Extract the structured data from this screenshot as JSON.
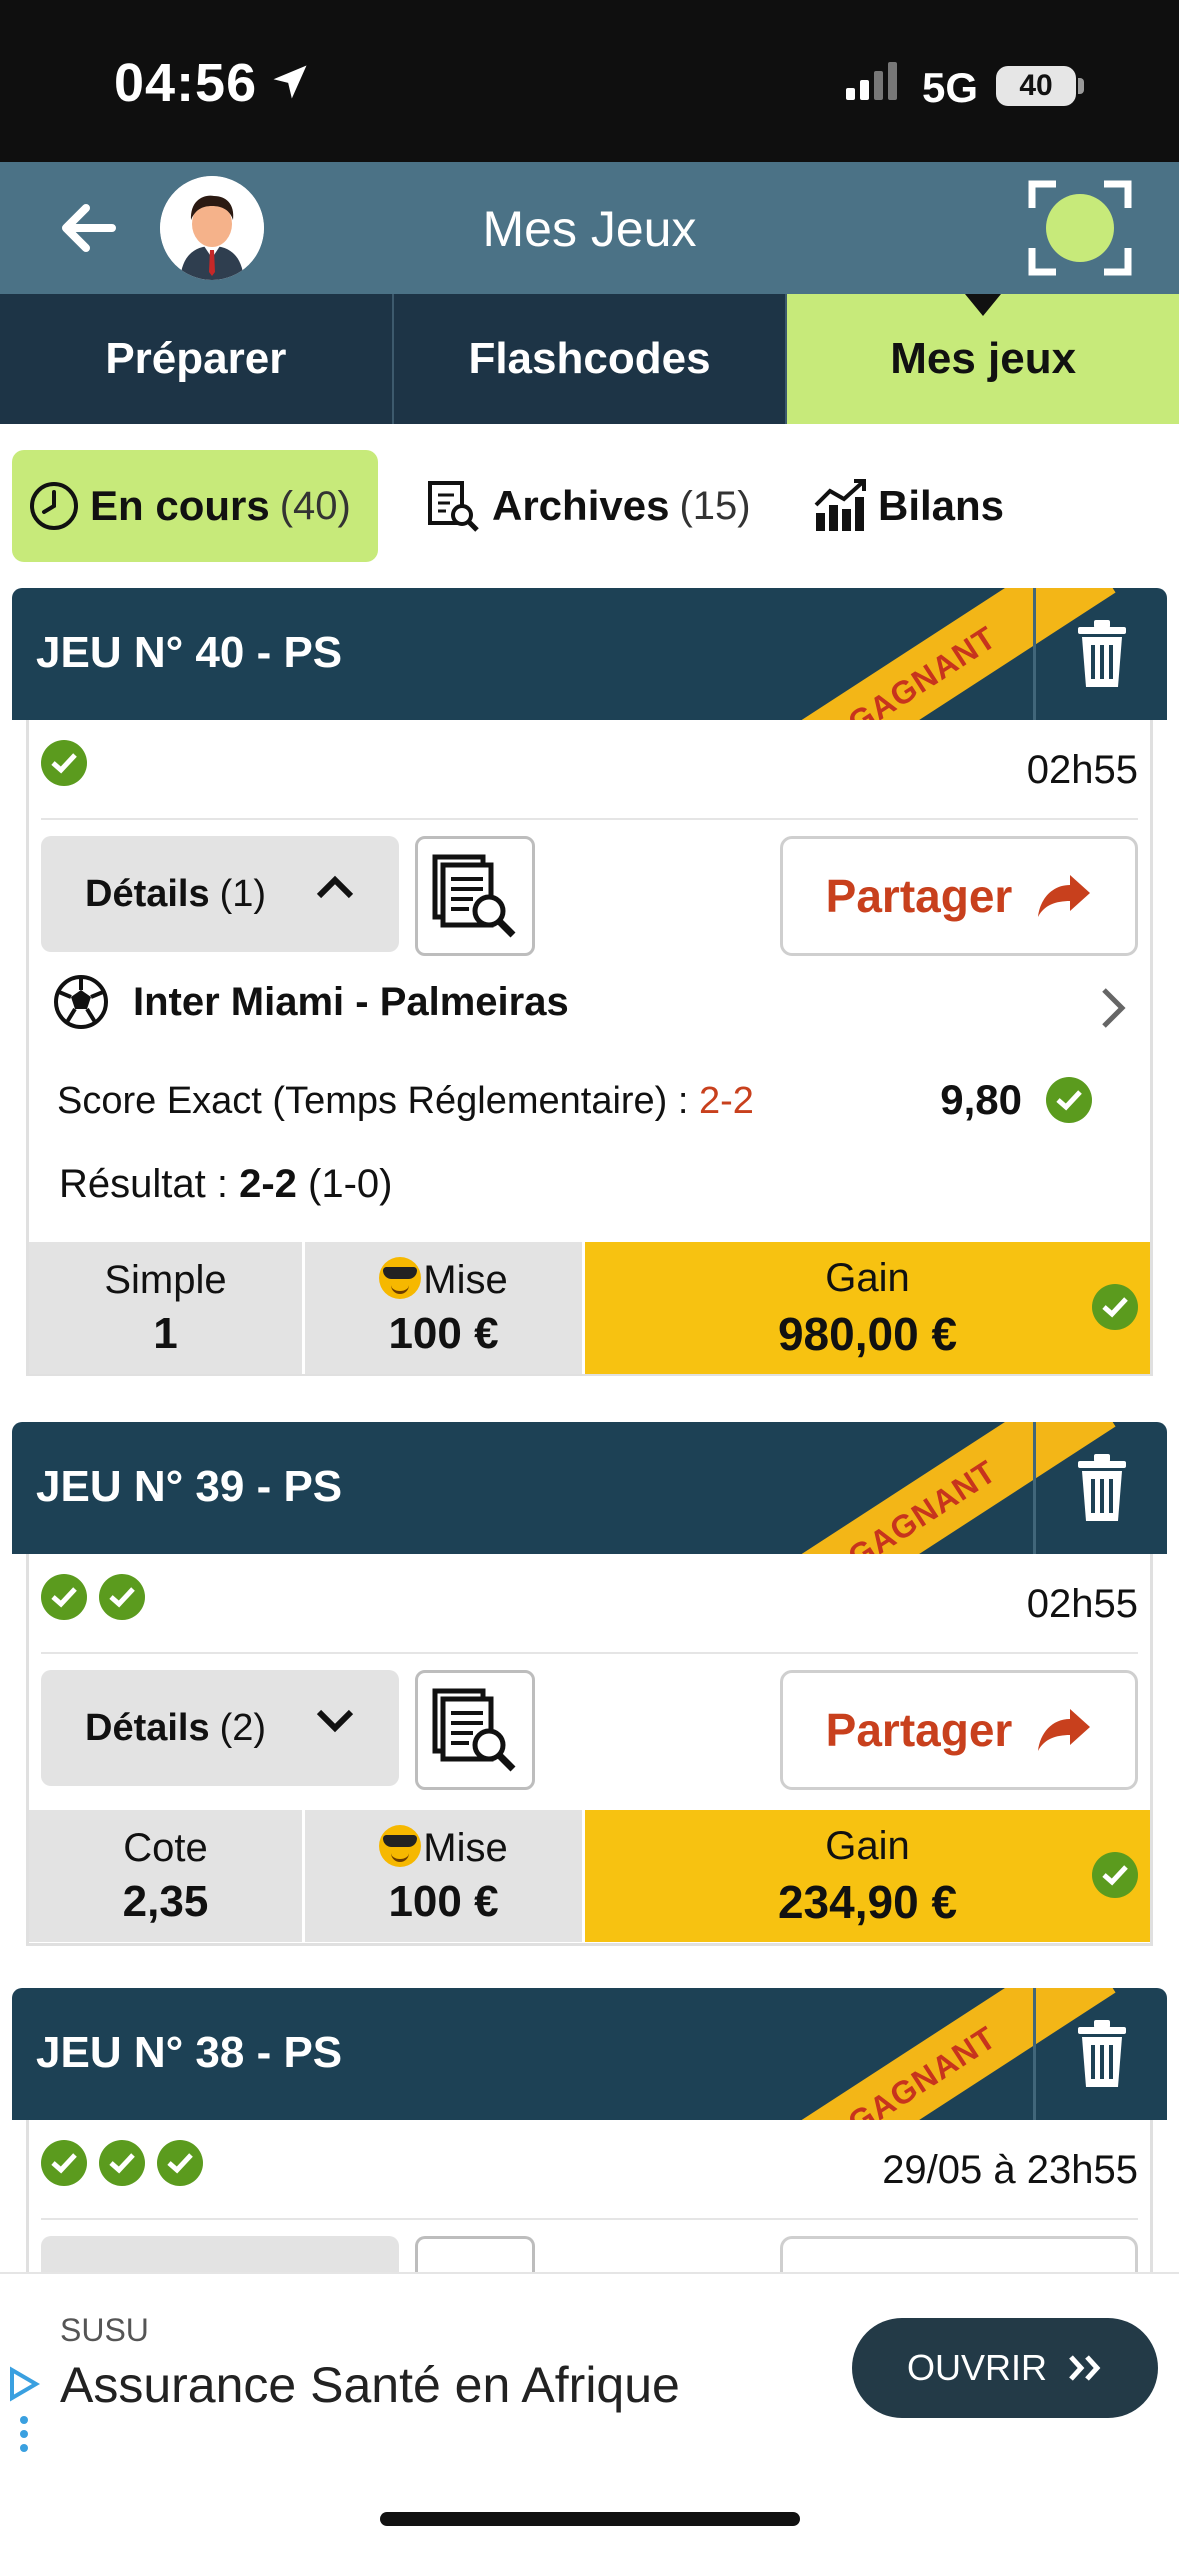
{
  "status_bar": {
    "time": "04:56",
    "network": "5G",
    "battery": "40"
  },
  "header": {
    "title": "Mes Jeux"
  },
  "tabs": [
    {
      "label": "Préparer",
      "active": false
    },
    {
      "label": "Flashcodes",
      "active": false
    },
    {
      "label": "Mes jeux",
      "active": true
    }
  ],
  "subtabs": {
    "en_cours": {
      "label": "En cours",
      "count": "(40)"
    },
    "archives": {
      "label": "Archives",
      "count": "(15)"
    },
    "bilans": {
      "label": "Bilans"
    }
  },
  "colors": {
    "accent_green": "#c7ea7a",
    "header_blue": "#4b7286",
    "card_navy": "#1d4155",
    "gain_yellow": "#f7c211",
    "share_red": "#c8401d",
    "check_green": "#5b9b1e"
  },
  "cards": [
    {
      "title": "JEU N° 40 - PS",
      "ribbon": "GAGNANT",
      "checks": 1,
      "time": "02h55",
      "details_label": "Détails",
      "details_count": "(1)",
      "share_label": "Partager",
      "match": "Inter Miami - Palmeiras",
      "bet_label": "Score Exact (Temps Réglementaire) :",
      "bet_score": "2-2",
      "odds": "9,80",
      "result_label": "Résultat :",
      "result_score": "2-2",
      "result_half": "(1-0)",
      "summary": {
        "type_label": "Simple",
        "type_value": "1",
        "stake_label": "Mise",
        "stake_value": "100 €",
        "gain_label": "Gain",
        "gain_value": "980,00 €"
      }
    },
    {
      "title": "JEU N° 39 - PS",
      "ribbon": "GAGNANT",
      "checks": 2,
      "time": "02h55",
      "details_label": "Détails",
      "details_count": "(2)",
      "share_label": "Partager",
      "summary": {
        "type_label": "Cote",
        "type_value": "2,35",
        "stake_label": "Mise",
        "stake_value": "100 €",
        "gain_label": "Gain",
        "gain_value": "234,90 €"
      }
    },
    {
      "title": "JEU N° 38 - PS",
      "ribbon": "GAGNANT",
      "checks": 3,
      "time": "29/05 à 23h55"
    }
  ],
  "ad": {
    "brand": "SUSU",
    "text": "Assurance Santé en Afrique",
    "button": "OUVRIR"
  }
}
